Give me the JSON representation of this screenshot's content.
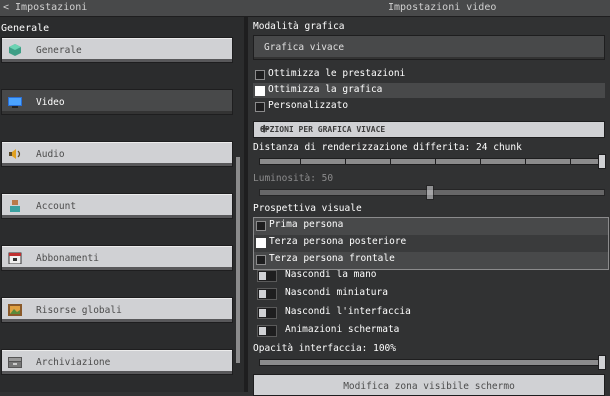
{
  "header": {
    "back_label": "< Impostazioni",
    "title": "Impostazioni video"
  },
  "sidebar": {
    "heading": "Generale",
    "items": [
      {
        "label": "Generale",
        "icon": "cube-icon"
      },
      {
        "label": "Video",
        "icon": "monitor-icon"
      },
      {
        "label": "Audio",
        "icon": "speaker-icon"
      },
      {
        "label": "Account",
        "icon": "user-icon"
      },
      {
        "label": "Abbonamenti",
        "icon": "calendar-icon"
      },
      {
        "label": "Risorse globali",
        "icon": "picture-icon"
      },
      {
        "label": "Archiviazione",
        "icon": "storage-icon"
      }
    ]
  },
  "main": {
    "graphics_mode_label": "Modalità grafica",
    "graphics_mode_value": "Grafica vivace",
    "options": [
      {
        "label": "Ottimizza le prestazioni",
        "checked": false
      },
      {
        "label": "Ottimizza la grafica",
        "checked": true
      },
      {
        "label": "Personalizzato",
        "checked": false
      }
    ],
    "expander_label": "OPZIONI PER GRAFICA VIVACE",
    "render_distance_label": "Distanza di renderizzazione differita: 24 chunk",
    "render_distance_value": 1.0,
    "brightness_label": "Luminosità: 50",
    "brightness_value": 0.5,
    "perspective_label": "Prospettiva visuale",
    "perspective_options": [
      {
        "label": "Prima persona",
        "checked": false
      },
      {
        "label": "Terza persona posteriore",
        "checked": true
      },
      {
        "label": "Terza persona frontale",
        "checked": false
      }
    ],
    "toggles": [
      {
        "label": "Nascondi la mano"
      },
      {
        "label": "Nascondi miniatura"
      },
      {
        "label": "Nascondi l'interfaccia"
      },
      {
        "label": "Animazioni schermata"
      }
    ],
    "opacity_label": "Opacità interfaccia: 100%",
    "opacity_value": 1.0,
    "bottom_button": "Modifica zona visibile schermo"
  }
}
